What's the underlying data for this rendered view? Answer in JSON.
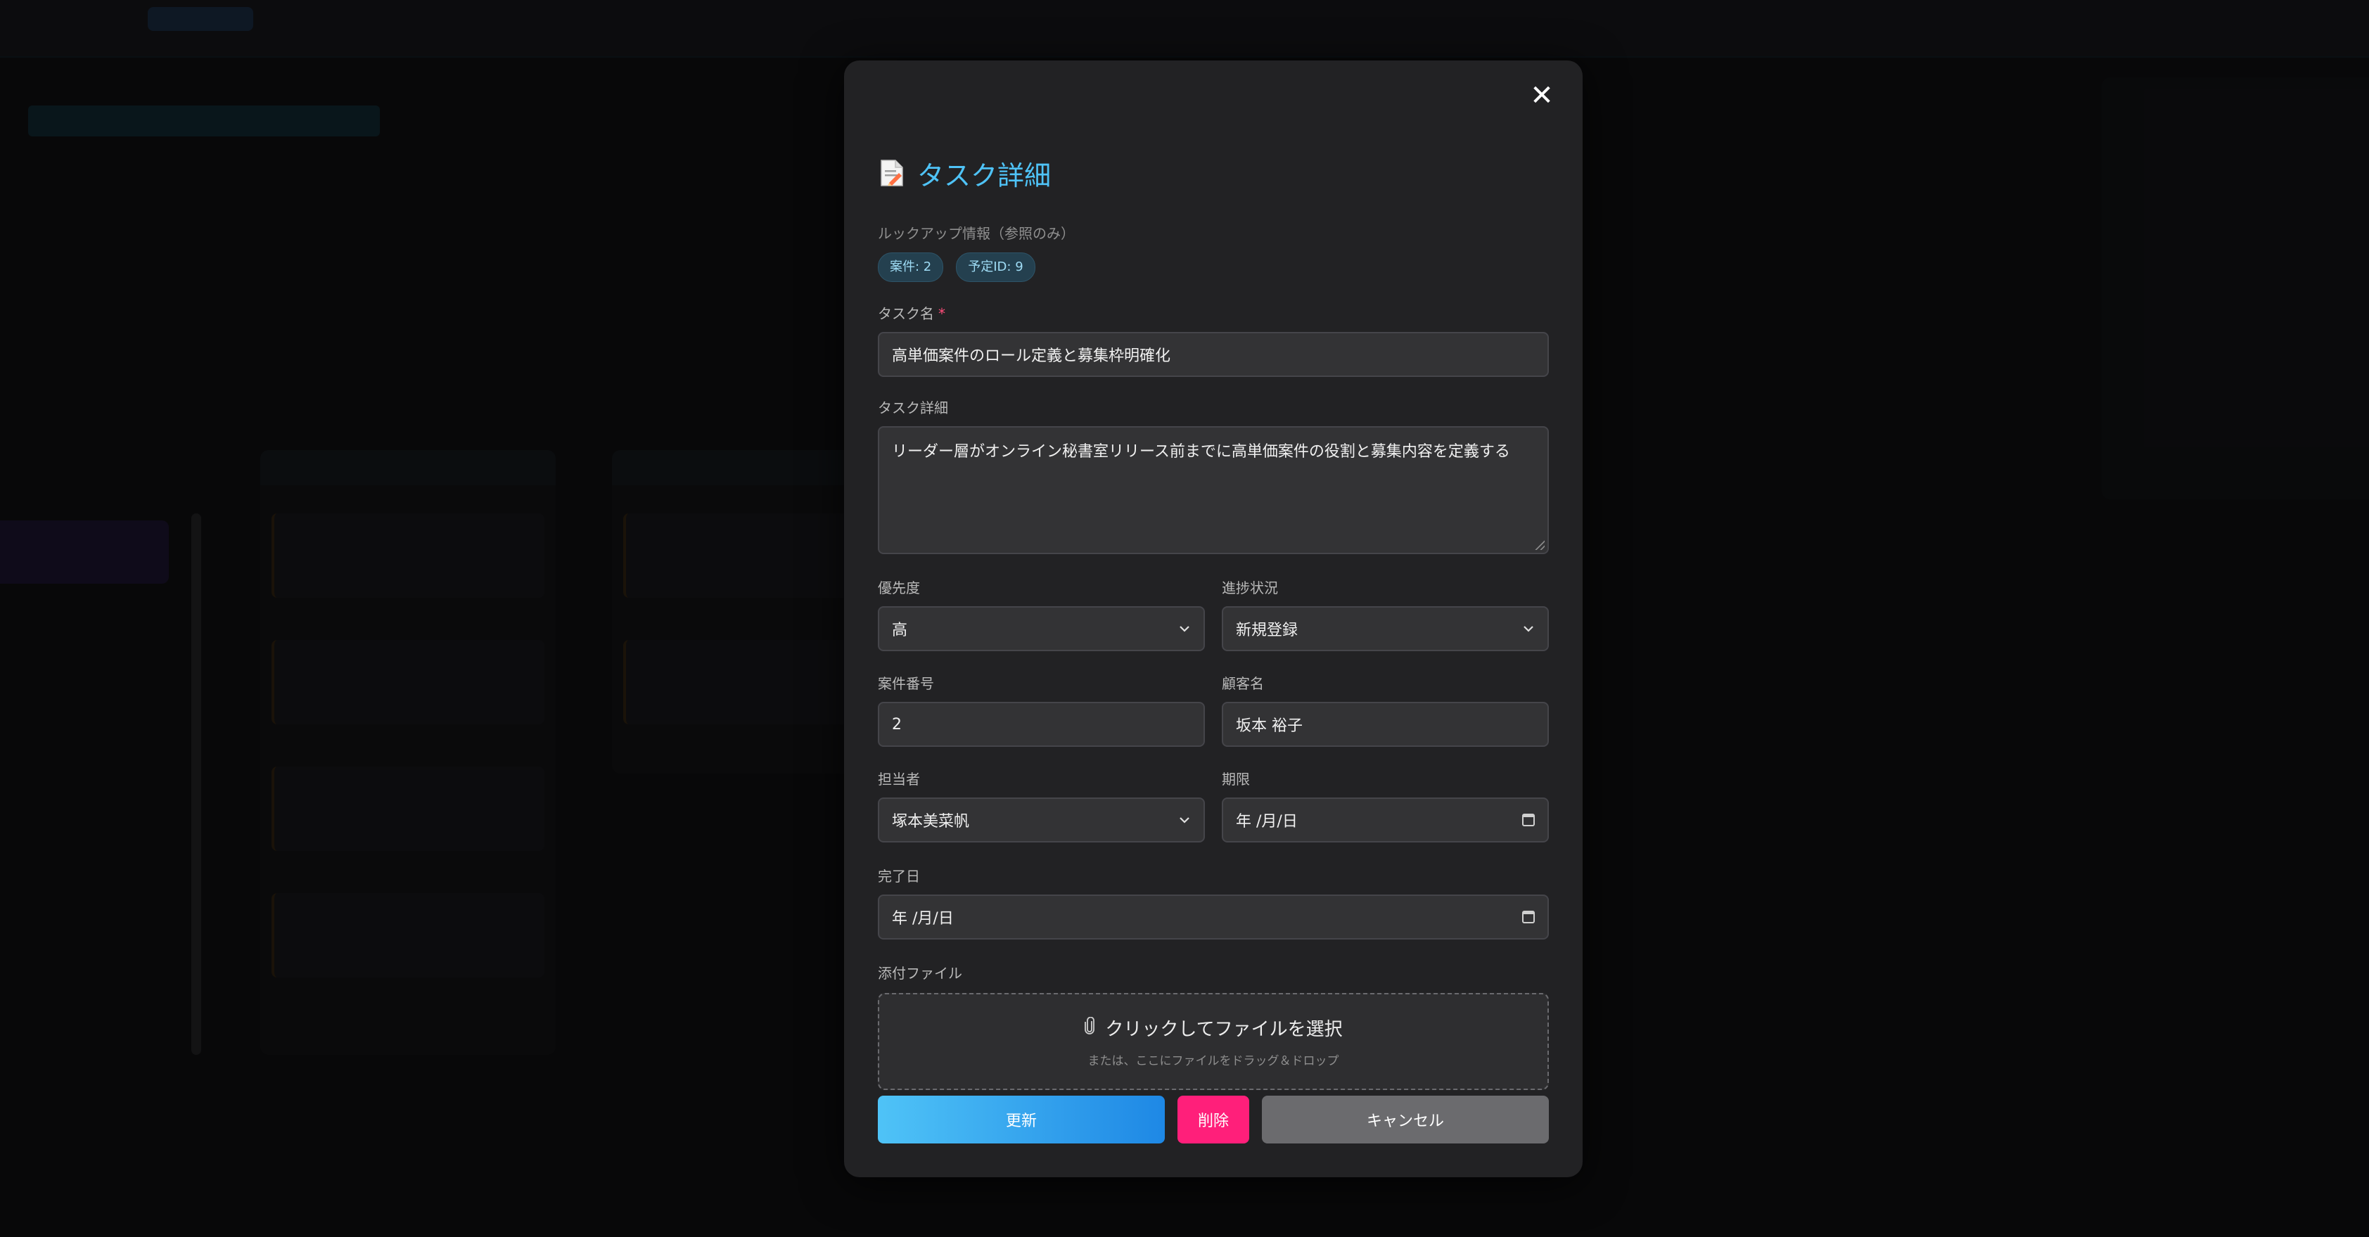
{
  "modal": {
    "title": "タスク詳細",
    "lookup": {
      "label": "ルックアップ情報（参照のみ）",
      "badges": [
        "案件: 2",
        "予定ID: 9"
      ]
    },
    "task_name": {
      "label": "タスク名",
      "required_mark": "*",
      "value": "高単価案件のロール定義と募集枠明確化"
    },
    "task_detail": {
      "label": "タスク詳細",
      "value": "リーダー層がオンライン秘書室リリース前までに高単価案件の役割と募集内容を定義する"
    },
    "priority": {
      "label": "優先度",
      "value": "高"
    },
    "status": {
      "label": "進捗状況",
      "value": "新規登録"
    },
    "case_number": {
      "label": "案件番号",
      "value": "2"
    },
    "customer_name": {
      "label": "顧客名",
      "value": "坂本 裕子"
    },
    "assignee": {
      "label": "担当者",
      "value": "塚本美菜帆"
    },
    "due_date": {
      "label": "期限",
      "value": "年 /月/日"
    },
    "completion_date": {
      "label": "完了日",
      "value": "年 /月/日"
    },
    "attachment": {
      "label": "添付ファイル",
      "main_text": "クリックしてファイルを選択",
      "sub_text": "または、ここにファイルをドラッグ＆ドロップ"
    },
    "buttons": {
      "update": "更新",
      "delete": "削除",
      "cancel": "キャンセル"
    },
    "close_symbol": "✕"
  },
  "colors": {
    "accent": "#4fc3f7",
    "delete": "#ff1f7a",
    "cancel": "#6b6b6e",
    "modal_bg": "#222224"
  }
}
